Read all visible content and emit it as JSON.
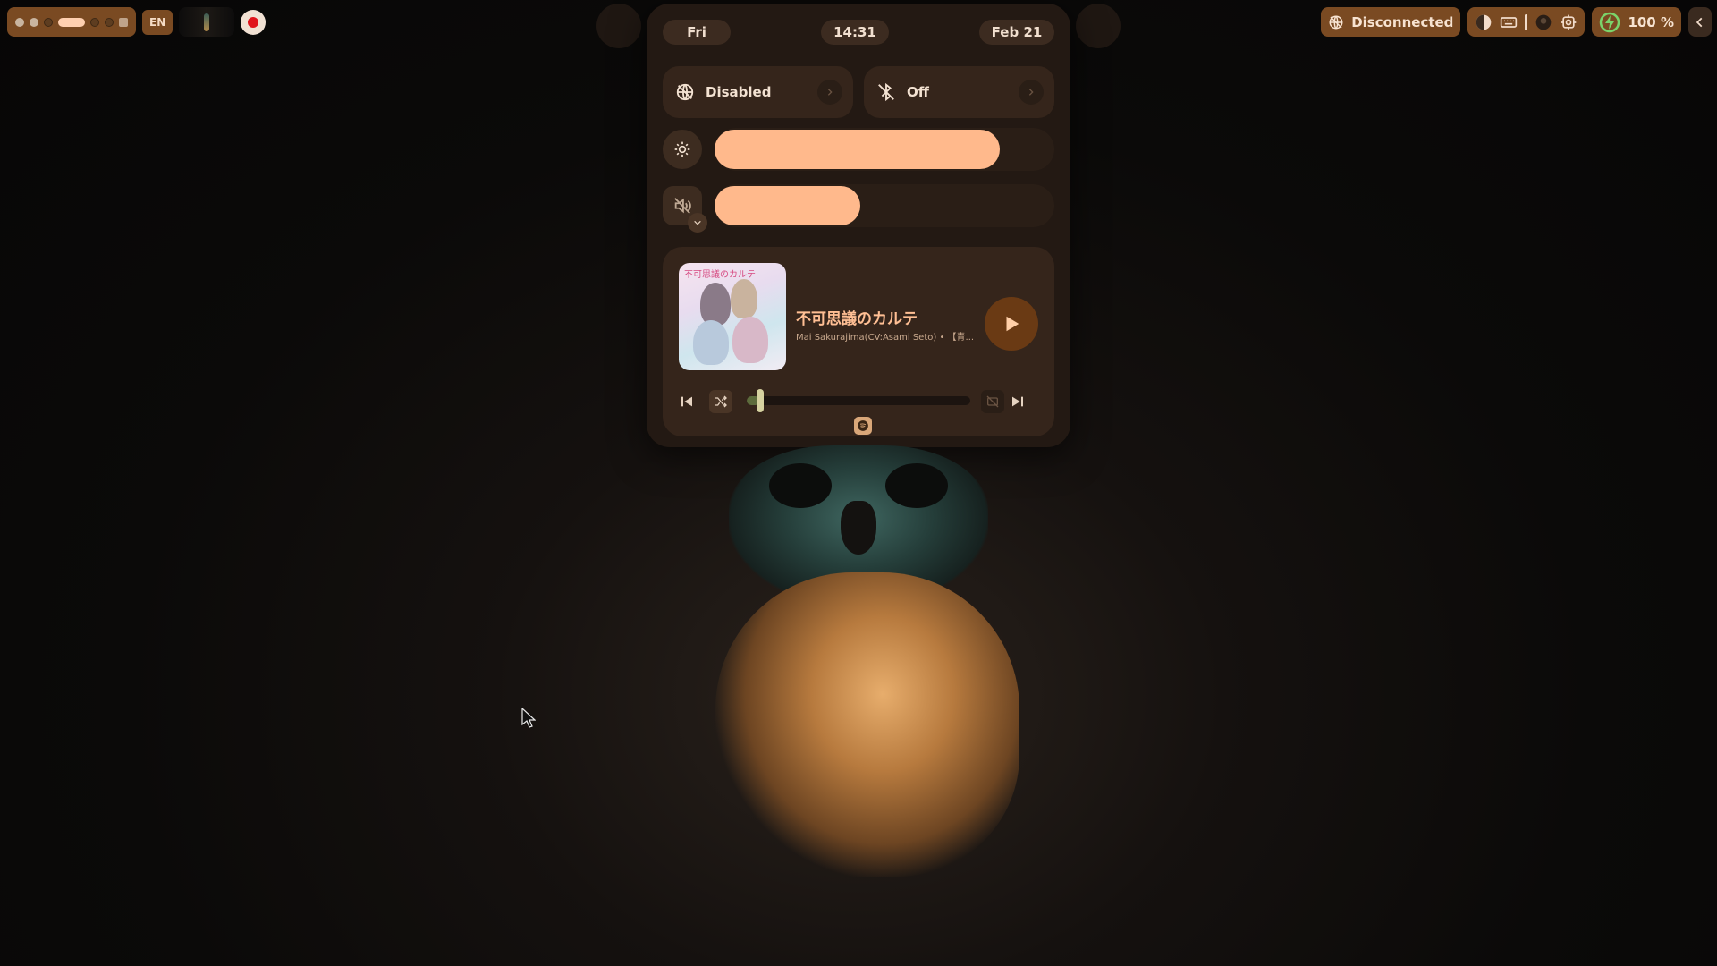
{
  "topbar": {
    "language": "EN",
    "network_status": "Disconnected",
    "battery": "100 %"
  },
  "panel": {
    "day": "Fri",
    "time": "14:31",
    "date": "Feb 21",
    "toggles": [
      {
        "label": "Disabled",
        "icon": "network-off-icon"
      },
      {
        "label": "Off",
        "icon": "bluetooth-off-icon"
      }
    ],
    "brightness_level": 0.84,
    "volume_level": 0.43,
    "volume_muted": true
  },
  "media": {
    "title": "不可思議のカルテ",
    "artist": "Mai Sakurajima(CV:Asami Seto) • 【青...",
    "cover_text": "不可思議のカルテ",
    "progress": 0.06,
    "source": "spotify-icon"
  },
  "colors": {
    "accent": "#ffb98c",
    "chip": "#7a4a22",
    "panel": "#231913"
  }
}
